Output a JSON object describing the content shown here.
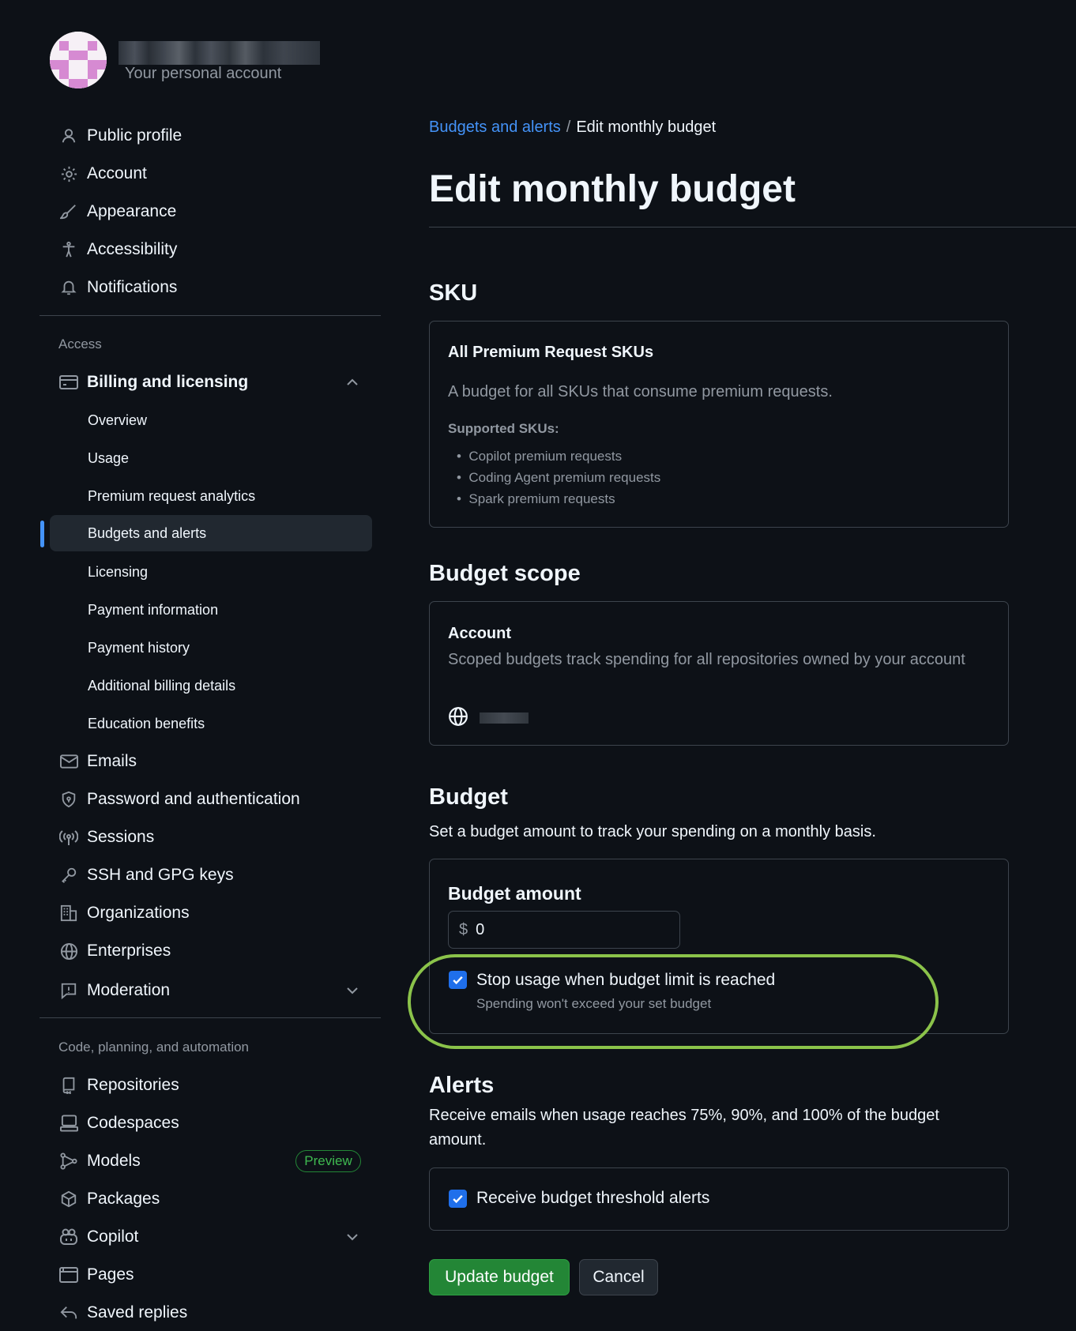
{
  "account": {
    "subtitle": "Your personal account"
  },
  "sidebar": {
    "top_items": [
      {
        "label": "Public profile"
      },
      {
        "label": "Account"
      },
      {
        "label": "Appearance"
      },
      {
        "label": "Accessibility"
      },
      {
        "label": "Notifications"
      }
    ],
    "access_heading": "Access",
    "billing": {
      "label": "Billing and licensing",
      "subitems": [
        {
          "label": "Overview"
        },
        {
          "label": "Usage"
        },
        {
          "label": "Premium request analytics"
        },
        {
          "label": "Budgets and alerts"
        },
        {
          "label": "Licensing"
        },
        {
          "label": "Payment information"
        },
        {
          "label": "Payment history"
        },
        {
          "label": "Additional billing details"
        },
        {
          "label": "Education benefits"
        }
      ]
    },
    "access_items": [
      {
        "label": "Emails"
      },
      {
        "label": "Password and authentication"
      },
      {
        "label": "Sessions"
      },
      {
        "label": "SSH and GPG keys"
      },
      {
        "label": "Organizations"
      },
      {
        "label": "Enterprises"
      },
      {
        "label": "Moderation"
      }
    ],
    "code_heading": "Code, planning, and automation",
    "code_items": [
      {
        "label": "Repositories"
      },
      {
        "label": "Codespaces"
      },
      {
        "label": "Models",
        "badge": "Preview"
      },
      {
        "label": "Packages"
      },
      {
        "label": "Copilot"
      },
      {
        "label": "Pages"
      },
      {
        "label": "Saved replies"
      }
    ]
  },
  "breadcrumb": {
    "parent": "Budgets and alerts",
    "separator": "/",
    "current": "Edit monthly budget"
  },
  "page_title": "Edit monthly budget",
  "sku": {
    "heading": "SKU",
    "title": "All Premium Request SKUs",
    "description": "A budget for all SKUs that consume premium requests.",
    "supported_label": "Supported SKUs:",
    "items": [
      "Copilot premium requests",
      "Coding Agent premium requests",
      "Spark premium requests"
    ]
  },
  "scope": {
    "heading": "Budget scope",
    "title": "Account",
    "description": "Scoped budgets track spending for all repositories owned by your account"
  },
  "budget": {
    "heading": "Budget",
    "description": "Set a budget amount to track your spending on a monthly basis.",
    "amount_label": "Budget amount",
    "currency": "$",
    "amount_value": "0",
    "stop_label": "Stop usage when budget limit is reached",
    "stop_hint": "Spending won't exceed your set budget",
    "stop_checked": true
  },
  "alerts": {
    "heading": "Alerts",
    "description": "Receive emails when usage reaches 75%, 90%, and 100% of the budget amount.",
    "checkbox_label": "Receive budget threshold alerts",
    "checked": true
  },
  "actions": {
    "update": "Update budget",
    "cancel": "Cancel"
  },
  "colors": {
    "accent": "#4493f8",
    "primary_button": "#238636",
    "highlight": "#8bc34a"
  }
}
